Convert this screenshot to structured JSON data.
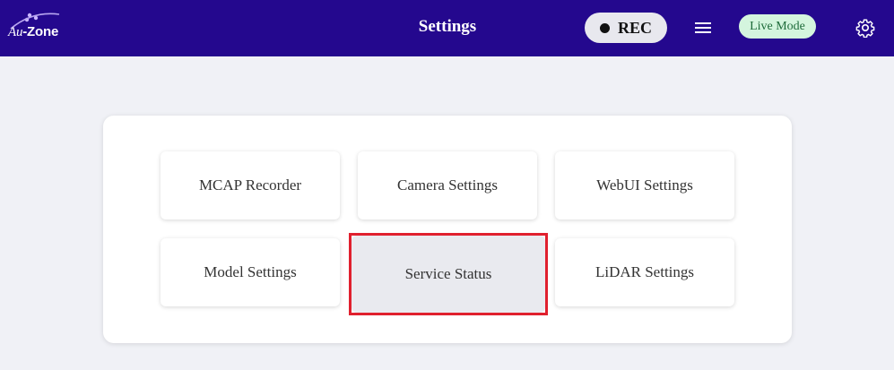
{
  "header": {
    "logo_prefix": "Au",
    "logo_suffix": "-Zone",
    "title": "Settings",
    "rec_label": "REC",
    "live_mode_label": "Live Mode"
  },
  "settings": {
    "items": [
      {
        "label": "MCAP Recorder"
      },
      {
        "label": "Camera Settings"
      },
      {
        "label": "WebUI Settings"
      },
      {
        "label": "Model Settings"
      },
      {
        "label": "Service Status",
        "selected": true
      },
      {
        "label": "LiDAR Settings"
      }
    ]
  },
  "colors": {
    "header_bg": "#24088e",
    "page_bg": "#f0f1f6",
    "live_badge_bg": "#d4f5de",
    "highlight_border": "#e0202e"
  },
  "icons": {
    "menu": "hamburger-icon",
    "settings": "gear-icon",
    "record": "record-dot-icon"
  }
}
